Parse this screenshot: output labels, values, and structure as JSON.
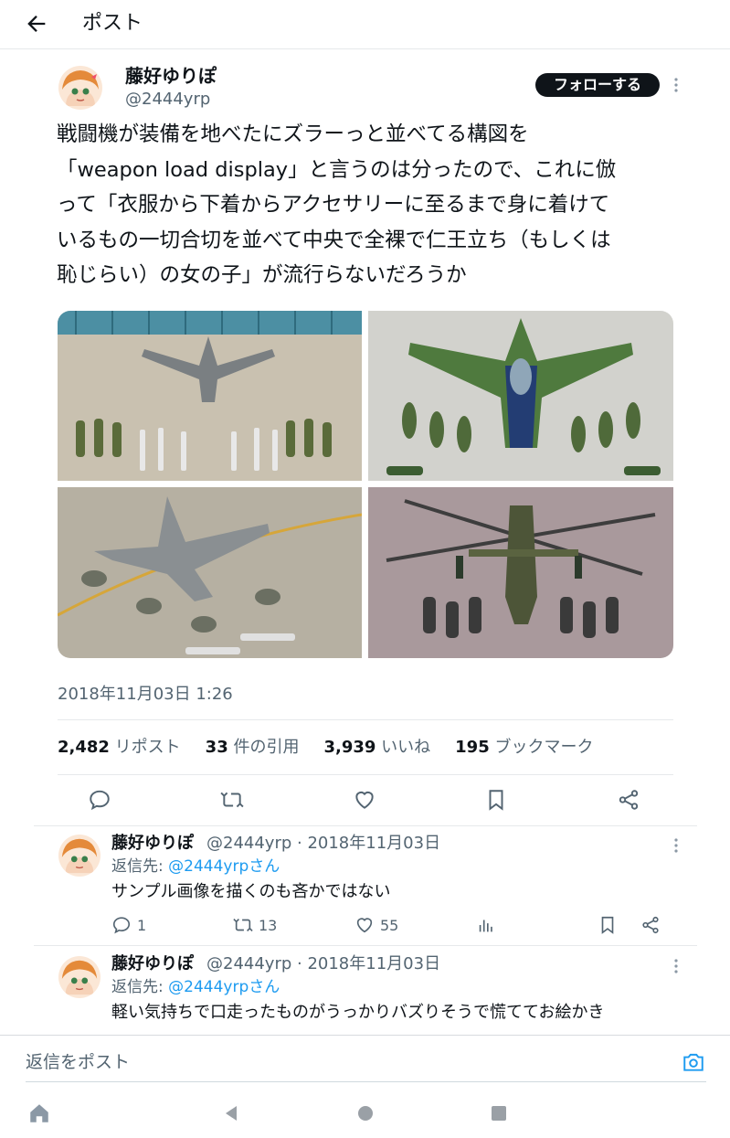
{
  "header": {
    "title": "ポスト"
  },
  "tweet": {
    "author_name": "藤好ゆりぽ",
    "author_handle": "@2444yrp",
    "follow_label": "フォローする",
    "text": "戦闘機が装備を地べたにズラーっと並べてる構図を\n「weapon load display」と言うのは分ったので、これに倣\nって「衣服から下着からアクセサリーに至るまで身に着けて\nいるもの一切合切を並べて中央で全裸で仁王立ち（もしくは\n恥じらい）の女の子」が流行らないだろうか",
    "timestamp": "2018年11月03日 1:26",
    "stats": [
      {
        "count": "2,482",
        "label": "リポスト"
      },
      {
        "count": "33",
        "label": "件の引用"
      },
      {
        "count": "3,939",
        "label": "いいね"
      },
      {
        "count": "195",
        "label": "ブックマーク"
      }
    ]
  },
  "replies": [
    {
      "name": "藤好ゆりぽ",
      "meta": "@2444yrp · 2018年11月03日",
      "reply_to_prefix": "返信先: ",
      "reply_to_handle": "@2444yrpさん",
      "text": "サンプル画像を描くのも吝かではない",
      "counts": {
        "replies": "1",
        "reposts": "13",
        "likes": "55"
      }
    },
    {
      "name": "藤好ゆりぽ",
      "meta": "@2444yrp · 2018年11月03日",
      "reply_to_prefix": "返信先: ",
      "reply_to_handle": "@2444yrpさん",
      "text": "軽い気持ちで口走ったものがうっかりバズりそうで慌ててお絵かき"
    }
  ],
  "compose": {
    "placeholder": "返信をポスト"
  },
  "colors": {
    "accent": "#1d9bf0",
    "text": "#0f1419",
    "secondary": "#536471"
  }
}
